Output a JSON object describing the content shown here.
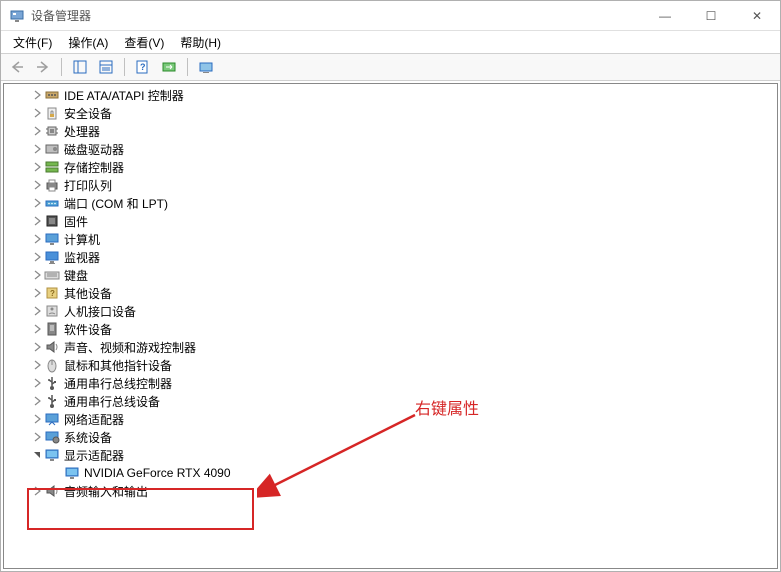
{
  "window": {
    "title": "设备管理器",
    "min": "—",
    "max": "☐",
    "close": "✕"
  },
  "menu": {
    "file": "文件(F)",
    "action": "操作(A)",
    "view": "查看(V)",
    "help": "帮助(H)"
  },
  "tree": {
    "items": [
      {
        "label": "IDE ATA/ATAPI 控制器",
        "icon": "ide",
        "expanded": false,
        "level": 1
      },
      {
        "label": "安全设备",
        "icon": "security",
        "expanded": false,
        "level": 1
      },
      {
        "label": "处理器",
        "icon": "cpu",
        "expanded": false,
        "level": 1
      },
      {
        "label": "磁盘驱动器",
        "icon": "disk",
        "expanded": false,
        "level": 1
      },
      {
        "label": "存储控制器",
        "icon": "storage",
        "expanded": false,
        "level": 1
      },
      {
        "label": "打印队列",
        "icon": "printer",
        "expanded": false,
        "level": 1
      },
      {
        "label": "端口 (COM 和 LPT)",
        "icon": "port",
        "expanded": false,
        "level": 1
      },
      {
        "label": "固件",
        "icon": "firmware",
        "expanded": false,
        "level": 1
      },
      {
        "label": "计算机",
        "icon": "computer",
        "expanded": false,
        "level": 1
      },
      {
        "label": "监视器",
        "icon": "monitor",
        "expanded": false,
        "level": 1
      },
      {
        "label": "键盘",
        "icon": "keyboard",
        "expanded": false,
        "level": 1
      },
      {
        "label": "其他设备",
        "icon": "other",
        "expanded": false,
        "level": 1
      },
      {
        "label": "人机接口设备",
        "icon": "hid",
        "expanded": false,
        "level": 1
      },
      {
        "label": "软件设备",
        "icon": "software",
        "expanded": false,
        "level": 1
      },
      {
        "label": "声音、视频和游戏控制器",
        "icon": "audio",
        "expanded": false,
        "level": 1
      },
      {
        "label": "鼠标和其他指针设备",
        "icon": "mouse",
        "expanded": false,
        "level": 1
      },
      {
        "label": "通用串行总线控制器",
        "icon": "usb",
        "expanded": false,
        "level": 1
      },
      {
        "label": "通用串行总线设备",
        "icon": "usb",
        "expanded": false,
        "level": 1
      },
      {
        "label": "网络适配器",
        "icon": "network",
        "expanded": false,
        "level": 1
      },
      {
        "label": "系统设备",
        "icon": "system",
        "expanded": false,
        "level": 1
      },
      {
        "label": "显示适配器",
        "icon": "display",
        "expanded": true,
        "level": 1
      },
      {
        "label": "NVIDIA GeForce RTX 4090",
        "icon": "display",
        "expanded": null,
        "level": 2
      },
      {
        "label": "音频输入和输出",
        "icon": "audio",
        "expanded": false,
        "level": 1
      }
    ]
  },
  "annotation": {
    "text": "右键属性",
    "color": "#d62626"
  }
}
